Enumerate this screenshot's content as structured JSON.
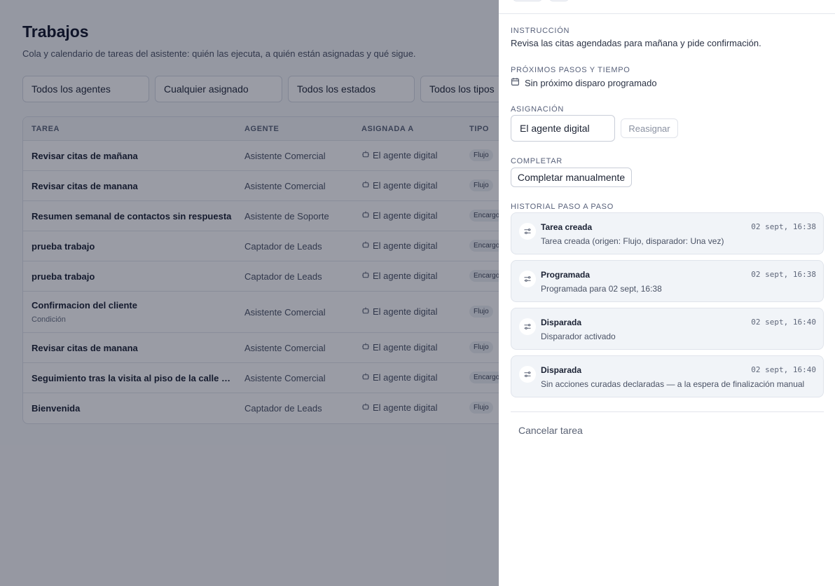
{
  "page": {
    "title": "Trabajos",
    "subtitle": "Cola y calendario de tareas del asistente: quién las ejecuta, a quién están asignadas y qué sigue."
  },
  "filters": {
    "agents": "Todos los agentes",
    "assignee": "Cualquier asignado",
    "states": "Todos los estados",
    "types": "Todos los tipos"
  },
  "table": {
    "columns": {
      "task": "TAREA",
      "agent": "AGENTE",
      "assigned": "ASIGNADA A",
      "type": "TIPO"
    },
    "rows": [
      {
        "task": "Revisar citas de mañana",
        "sub": "",
        "agent": "Asistente Comercial",
        "assigned": "El agente digital",
        "type": "Flujo"
      },
      {
        "task": "Revisar citas de manana",
        "sub": "",
        "agent": "Asistente Comercial",
        "assigned": "El agente digital",
        "type": "Flujo"
      },
      {
        "task": "Resumen semanal de contactos sin respuesta",
        "sub": "",
        "agent": "Asistente de Soporte",
        "assigned": "El agente digital",
        "type": "Encargo"
      },
      {
        "task": "prueba trabajo",
        "sub": "",
        "agent": "Captador de Leads",
        "assigned": "El agente digital",
        "type": "Encargo"
      },
      {
        "task": "prueba trabajo",
        "sub": "",
        "agent": "Captador de Leads",
        "assigned": "El agente digital",
        "type": "Encargo"
      },
      {
        "task": "Confirmacion del cliente",
        "sub": "Condición",
        "agent": "Asistente Comercial",
        "assigned": "El agente digital",
        "type": "Flujo"
      },
      {
        "task": "Revisar citas de manana",
        "sub": "",
        "agent": "Asistente Comercial",
        "assigned": "El agente digital",
        "type": "Flujo"
      },
      {
        "task": "Seguimiento tras la visita al piso de la calle Ma...",
        "sub": "",
        "agent": "Asistente Comercial",
        "assigned": "El agente digital",
        "type": "Encargo"
      },
      {
        "task": "Bienvenida",
        "sub": "",
        "agent": "Captador de Leads",
        "assigned": "El agente digital",
        "type": "Flujo"
      }
    ]
  },
  "drawer": {
    "instruction_label": "INSTRUCCIÓN",
    "instruction_text": "Revisa las citas agendadas para mañana y pide confirmación.",
    "next_label": "PRÓXIMOS PASOS Y TIEMPO",
    "next_text": "Sin próximo disparo programado",
    "assignment_label": "ASIGNACIÓN",
    "assignment_value": "El agente digital",
    "reassign_button": "Reasignar",
    "complete_label": "COMPLETAR",
    "complete_button": "Completar manualmente",
    "history_label": "HISTORIAL PASO A PASO",
    "history": [
      {
        "title": "Tarea creada",
        "date": "02 sept, 16:38",
        "desc": "Tarea creada (origen: Flujo, disparador: Una vez)"
      },
      {
        "title": "Programada",
        "date": "02 sept, 16:38",
        "desc": "Programada para 02 sept, 16:38"
      },
      {
        "title": "Disparada",
        "date": "02 sept, 16:40",
        "desc": "Disparador activado"
      },
      {
        "title": "Disparada",
        "date": "02 sept, 16:40",
        "desc": "Sin acciones curadas declaradas — a la espera de finalización manual"
      }
    ],
    "cancel_button": "Cancelar tarea"
  },
  "icons": {
    "assignee": "robot-icon",
    "next": "calendar-icon",
    "history": "sliders-icon"
  },
  "colors": {
    "overlay": "#0f1428",
    "history_card": "#f1f4f8",
    "title": "#10162a"
  }
}
